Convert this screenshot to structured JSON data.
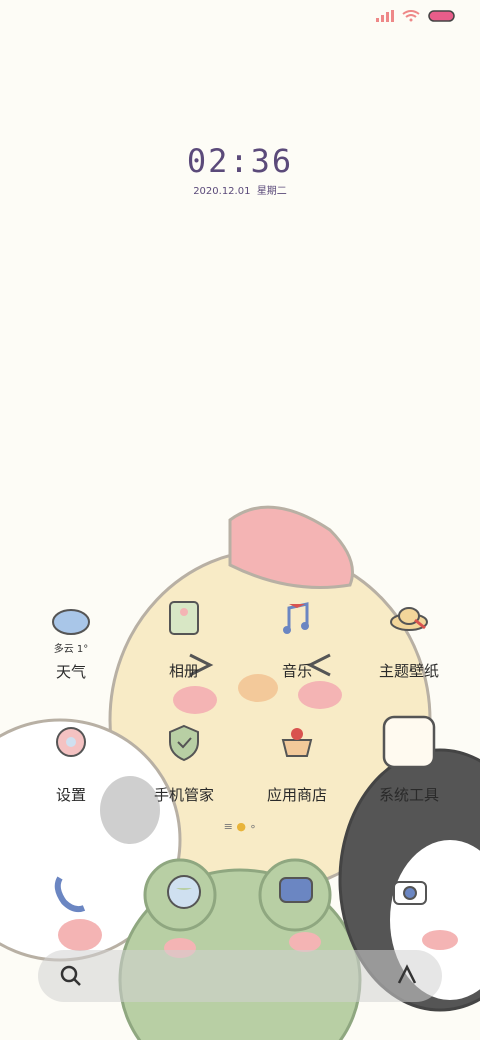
{
  "status": {
    "battery_color": "#e85d8a"
  },
  "clock": {
    "time": "02:36",
    "date": "2020.12.01",
    "weekday": "星期二"
  },
  "weather": {
    "condition": "多云",
    "temp": "1°"
  },
  "apps_row1": [
    "天气",
    "相册",
    "音乐",
    "主题壁纸"
  ],
  "apps_row2": [
    "设置",
    "手机管家",
    "应用商店",
    "系统工具"
  ],
  "dock": [
    "phone",
    "browser",
    "messages",
    "camera"
  ],
  "colors": {
    "accent": "#5b4a7a",
    "pink": "#f4b4b4",
    "chick": "#f8ebc6"
  }
}
